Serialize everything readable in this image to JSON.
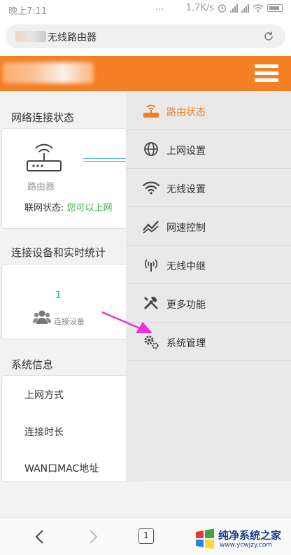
{
  "status_bar": {
    "time": "晚上7:11",
    "dots": "...",
    "speed": "1.7K/s"
  },
  "browser": {
    "page_title": "无线路由器"
  },
  "network_status": {
    "title": "网络连接状态",
    "router_label": "路由器",
    "status_label": "联网状态:",
    "status_value": "您可以上网"
  },
  "devices": {
    "title": "连接设备和实时统计",
    "count": "1",
    "label": "连接设备"
  },
  "system_info": {
    "title": "系统信息",
    "rows": [
      "上网方式",
      "连接时长",
      "WAN口MAC地址"
    ]
  },
  "menu": {
    "items": [
      {
        "label": "路由状态",
        "icon": "router-icon"
      },
      {
        "label": "上网设置",
        "icon": "globe-icon"
      },
      {
        "label": "无线设置",
        "icon": "wifi-icon"
      },
      {
        "label": "网速控制",
        "icon": "speed-icon"
      },
      {
        "label": "无线中继",
        "icon": "antenna-icon"
      },
      {
        "label": "更多功能",
        "icon": "tools-icon"
      },
      {
        "label": "系统管理",
        "icon": "gear-icon"
      }
    ],
    "active_color": "#f47f24"
  },
  "bottom_nav": {
    "tab_count": "1"
  },
  "watermark": {
    "text": "纯净系统之家",
    "url": "www.ycwjzy.com"
  },
  "colors": {
    "header": "#f47f24",
    "ok_green": "#2cb24a",
    "arrow_pink": "#ee2fd8"
  }
}
